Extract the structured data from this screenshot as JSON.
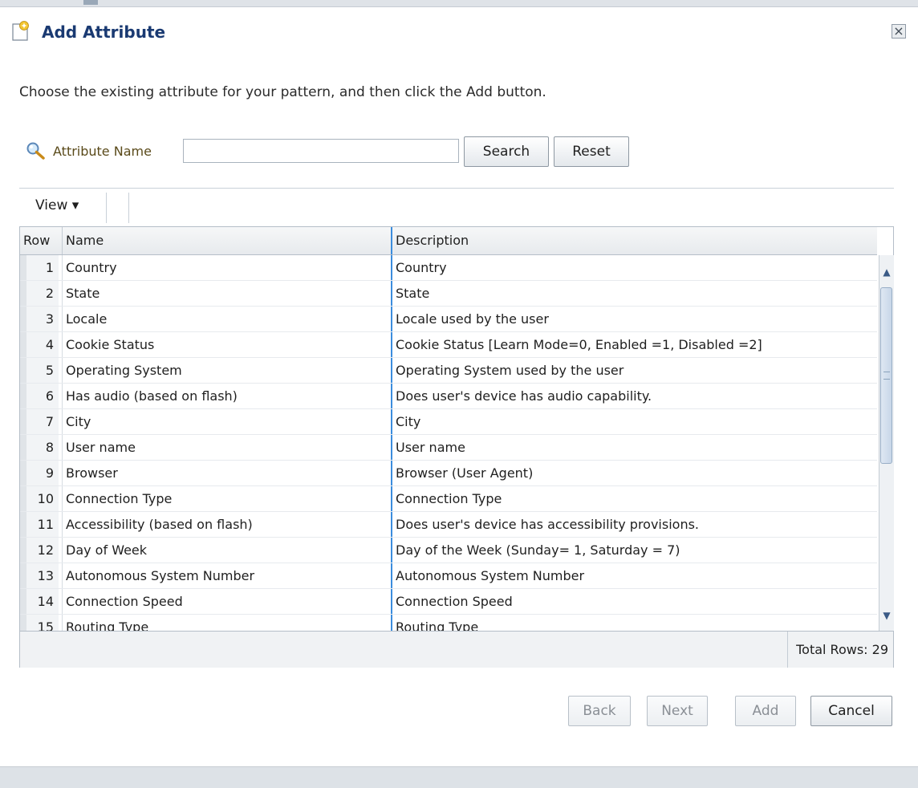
{
  "dialog": {
    "title": "Add Attribute",
    "close_glyph": "×",
    "instruction": "Choose the existing attribute for your pattern, and then click the Add button."
  },
  "search": {
    "label": "Attribute Name",
    "value": "",
    "search_label": "Search",
    "reset_label": "Reset"
  },
  "toolbar": {
    "view_label": "View ▾"
  },
  "table": {
    "columns": {
      "row": "Row",
      "name": "Name",
      "description": "Description"
    },
    "rows": [
      {
        "num": "1",
        "name": "Country",
        "desc": "Country"
      },
      {
        "num": "2",
        "name": "State",
        "desc": "State"
      },
      {
        "num": "3",
        "name": "Locale",
        "desc": "Locale used by the user"
      },
      {
        "num": "4",
        "name": "Cookie Status",
        "desc": "Cookie Status [Learn Mode=0, Enabled =1, Disabled =2]"
      },
      {
        "num": "5",
        "name": "Operating System",
        "desc": "Operating System used by the user"
      },
      {
        "num": "6",
        "name": "Has audio (based on flash)",
        "desc": "Does user's device has audio capability."
      },
      {
        "num": "7",
        "name": "City",
        "desc": "City"
      },
      {
        "num": "8",
        "name": "User name",
        "desc": "User name"
      },
      {
        "num": "9",
        "name": "Browser",
        "desc": "Browser (User Agent)"
      },
      {
        "num": "10",
        "name": "Connection Type",
        "desc": "Connection Type"
      },
      {
        "num": "11",
        "name": "Accessibility (based on flash)",
        "desc": "Does user's device has accessibility provisions."
      },
      {
        "num": "12",
        "name": "Day of Week",
        "desc": "Day of the Week (Sunday= 1, Saturday = 7)"
      },
      {
        "num": "13",
        "name": "Autonomous System Number",
        "desc": "Autonomous System Number"
      },
      {
        "num": "14",
        "name": "Connection Speed",
        "desc": "Connection Speed"
      },
      {
        "num": "15",
        "name": "Routing Type",
        "desc": "Routing Type"
      }
    ],
    "total_rows": "Total Rows: 29"
  },
  "footer": {
    "back_label": "Back",
    "next_label": "Next",
    "add_label": "Add",
    "cancel_label": "Cancel"
  },
  "colors": {
    "title": "#1a3a72",
    "accent_line": "#3c8ddd",
    "disabled_text": "#8a8f95"
  }
}
